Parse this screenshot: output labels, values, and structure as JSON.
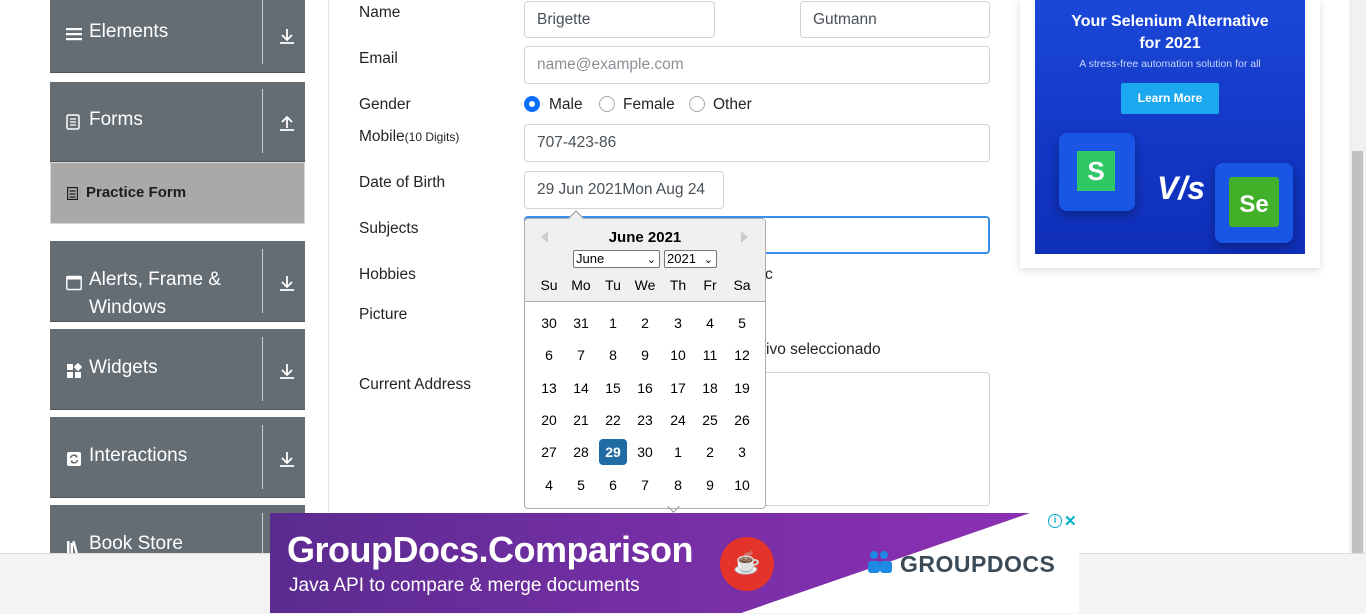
{
  "sidebar": {
    "groups": {
      "elements": "Elements",
      "forms": "Forms",
      "alerts_line1": "Alerts, Frame &",
      "alerts_line2": "Windows",
      "widgets": "Widgets",
      "interactions": "Interactions",
      "book_store": "Book Store"
    },
    "active_item": "Practice Form"
  },
  "form": {
    "name_label": "Name",
    "first_name": "Brigette",
    "last_name": "Gutmann",
    "email_label": "Email",
    "email_placeholder": "name@example.com",
    "gender_label": "Gender",
    "gender_options": [
      "Male",
      "Female",
      "Other"
    ],
    "gender_selected": "Male",
    "mobile_label": "Mobile",
    "mobile_hint": "(10 Digits)",
    "mobile_value": "707-423-86",
    "dob_label": "Date of Birth",
    "dob_value": "29 Jun 2021Mon Aug 24",
    "subjects_label": "Subjects",
    "hobbies_label": "Hobbies",
    "hobbies_overflow": "c",
    "picture_label": "Picture",
    "picture_overflow": "ivo seleccionado",
    "address_label": "Current Address"
  },
  "datepicker": {
    "title": "June 2021",
    "month_select": "June",
    "year_select": "2021",
    "weekdays": [
      "Su",
      "Mo",
      "Tu",
      "We",
      "Th",
      "Fr",
      "Sa"
    ],
    "weeks": [
      [
        "30",
        "31",
        "1",
        "2",
        "3",
        "4",
        "5"
      ],
      [
        "6",
        "7",
        "8",
        "9",
        "10",
        "11",
        "12"
      ],
      [
        "13",
        "14",
        "15",
        "16",
        "17",
        "18",
        "19"
      ],
      [
        "20",
        "21",
        "22",
        "23",
        "24",
        "25",
        "26"
      ],
      [
        "27",
        "28",
        "29",
        "30",
        "1",
        "2",
        "3"
      ],
      [
        "4",
        "5",
        "6",
        "7",
        "8",
        "9",
        "10"
      ]
    ],
    "selected_day": "29"
  },
  "ad_right": {
    "title_line1": "Your Selenium Alternative",
    "title_line2": "for 2021",
    "subtitle": "A stress-free automation solution for all",
    "button": "Learn More",
    "logo_left": "S",
    "vs": "V/s",
    "logo_right": "Se"
  },
  "ad_bottom": {
    "title": "GroupDocs.Comparison",
    "subtitle": "Java API to compare & merge documents",
    "brand": "GROUPDOCS"
  }
}
